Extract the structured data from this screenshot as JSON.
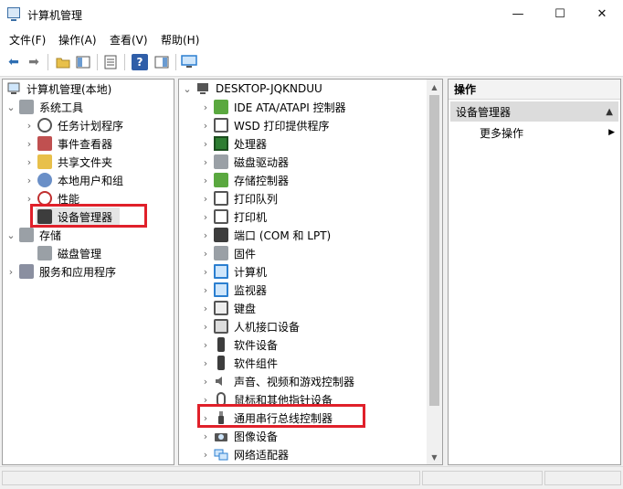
{
  "window": {
    "title": "计算机管理",
    "controls": {
      "minimize": "—",
      "maximize": "☐",
      "close": "✕"
    }
  },
  "menu": [
    "文件(F)",
    "操作(A)",
    "查看(V)",
    "帮助(H)"
  ],
  "toolbar": {
    "buttons": [
      "back-icon",
      "forward-icon",
      "up-folder-icon",
      "show-tree-icon",
      "properties-icon",
      "help-icon",
      "action-pane-icon",
      "monitor-icon"
    ],
    "back_glyph": "⬅",
    "forward_glyph": "➡",
    "help_glyph": "?"
  },
  "left_tree": {
    "root": "计算机管理(本地)",
    "items": [
      {
        "label": "系统工具",
        "chev": "⌄",
        "icon": "tools-icon"
      },
      {
        "label": "任务计划程序",
        "chev": "›",
        "icon": "clock-icon"
      },
      {
        "label": "事件查看器",
        "chev": "›",
        "icon": "event-viewer-icon"
      },
      {
        "label": "共享文件夹",
        "chev": "›",
        "icon": "shared-folder-icon"
      },
      {
        "label": "本地用户和组",
        "chev": "›",
        "icon": "users-icon"
      },
      {
        "label": "性能",
        "chev": "›",
        "icon": "performance-icon"
      },
      {
        "label": "设备管理器",
        "chev": "",
        "icon": "device-manager-icon"
      },
      {
        "label": "存储",
        "chev": "⌄",
        "icon": "storage-icon"
      },
      {
        "label": "磁盘管理",
        "chev": "",
        "icon": "disk-management-icon"
      },
      {
        "label": "服务和应用程序",
        "chev": "›",
        "icon": "services-icon"
      }
    ]
  },
  "device_tree": {
    "computer_name": "DESKTOP-JQKNDUU",
    "chev_open": "⌄",
    "chev_closed": "›",
    "categories": [
      {
        "label": "IDE ATA/ATAPI 控制器",
        "icon": "ide-controller-icon"
      },
      {
        "label": "WSD 打印提供程序",
        "icon": "wsd-printer-icon"
      },
      {
        "label": "处理器",
        "icon": "processor-icon"
      },
      {
        "label": "磁盘驱动器",
        "icon": "disk-drive-icon"
      },
      {
        "label": "存储控制器",
        "icon": "storage-controller-icon"
      },
      {
        "label": "打印队列",
        "icon": "print-queue-icon"
      },
      {
        "label": "打印机",
        "icon": "printer-icon"
      },
      {
        "label": "端口 (COM 和 LPT)",
        "icon": "port-icon"
      },
      {
        "label": "固件",
        "icon": "firmware-icon"
      },
      {
        "label": "计算机",
        "icon": "computer-icon"
      },
      {
        "label": "监视器",
        "icon": "monitor-icon"
      },
      {
        "label": "键盘",
        "icon": "keyboard-icon"
      },
      {
        "label": "人机接口设备",
        "icon": "hid-icon"
      },
      {
        "label": "软件设备",
        "icon": "software-device-icon"
      },
      {
        "label": "软件组件",
        "icon": "software-component-icon"
      },
      {
        "label": "声音、视频和游戏控制器",
        "icon": "sound-icon"
      },
      {
        "label": "鼠标和其他指针设备",
        "icon": "mouse-icon"
      },
      {
        "label": "通用串行总线控制器",
        "icon": "usb-icon"
      },
      {
        "label": "图像设备",
        "icon": "camera-icon"
      },
      {
        "label": "网络适配器",
        "icon": "network-adapter-icon"
      }
    ]
  },
  "actions": {
    "header": "操作",
    "section": "设备管理器",
    "section_arrow": "▲",
    "more": "更多操作",
    "more_arrow": "▶"
  },
  "highlights": {
    "color": "#e0202a",
    "left": "设备管理器",
    "middle": "通用串行总线控制器"
  },
  "scrollbar": {
    "up": "▲",
    "down": "▼"
  }
}
